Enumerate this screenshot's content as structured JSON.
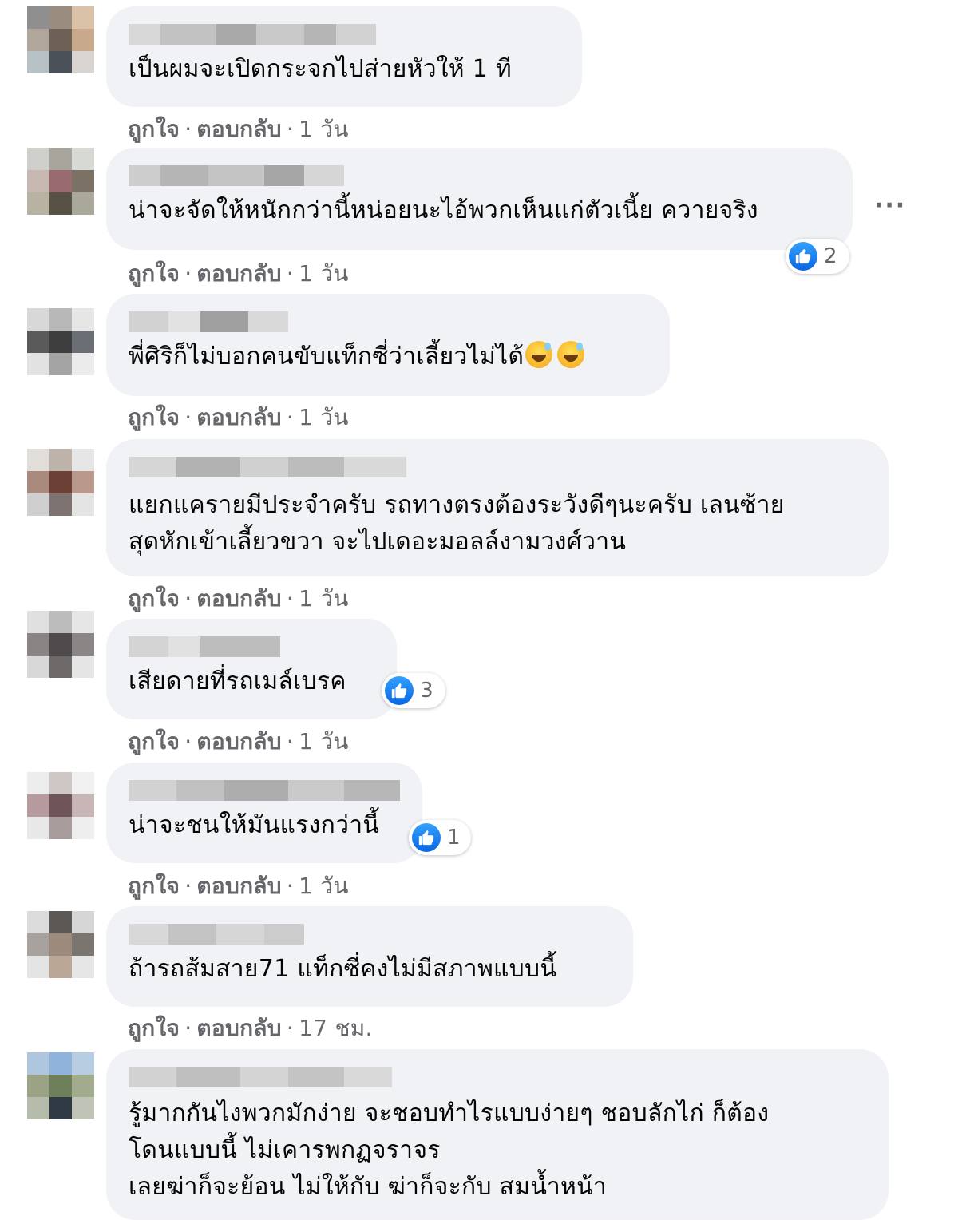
{
  "labels": {
    "like": "ถูกใจ",
    "reply": "ตอบกลับ",
    "separator": "·",
    "more": "···"
  },
  "comments": [
    {
      "text": "เป็นผมจะเปิดกระจกไปส่ายหัวให้ 1 ที",
      "time": "1 วัน",
      "likes": null
    },
    {
      "text": "น่าจะจัดให้หนักกว่านี้หน่อยนะไอ้พวกเห็นแก่ตัวเนี้ย ควายจริง",
      "time": "1 วัน",
      "likes": "2"
    },
    {
      "text": "พี่ศิริก็ไม่บอกคนขับแท็กซี่ว่าเลี้ยวไม่ได้",
      "time": "1 วัน",
      "likes": null
    },
    {
      "text": "แยกแครายมีประจำครับ รถทางตรงต้องระวังดีๆนะครับ เลนซ้าย\nสุดหักเข้าเลี้ยวขวา จะไปเดอะมอลล์งามวงศ์วาน",
      "time": "1 วัน",
      "likes": null
    },
    {
      "text": "เสียดายที่รถเมล์เบรค",
      "time": "1 วัน",
      "likes": "3"
    },
    {
      "text": "น่าจะชนให้มันแรงกว่านี้",
      "time": "1 วัน",
      "likes": "1"
    },
    {
      "text": "ถ้ารถส้มสาย71 แท็กซี่คงไม่มีสภาพแบบนี้",
      "time": "17 ชม.",
      "likes": null
    },
    {
      "text": "รู้มากกันไงพวกมักง่าย จะชอบทำไรแบบง่ายๆ ชอบลักไก่ ก็ต้อง\nโดนแบบนี้ ไม่เคารพกฏจราจร\nเลยฆ่าก็จะย้อน ไม่ให้กับ ฆ่าก็จะกับ สมน้ำหน้า",
      "time": null,
      "likes": null
    }
  ],
  "colors": {
    "bubble": "#f0f2f5",
    "meta": "#65676b",
    "like_blue": "#1877f2"
  }
}
